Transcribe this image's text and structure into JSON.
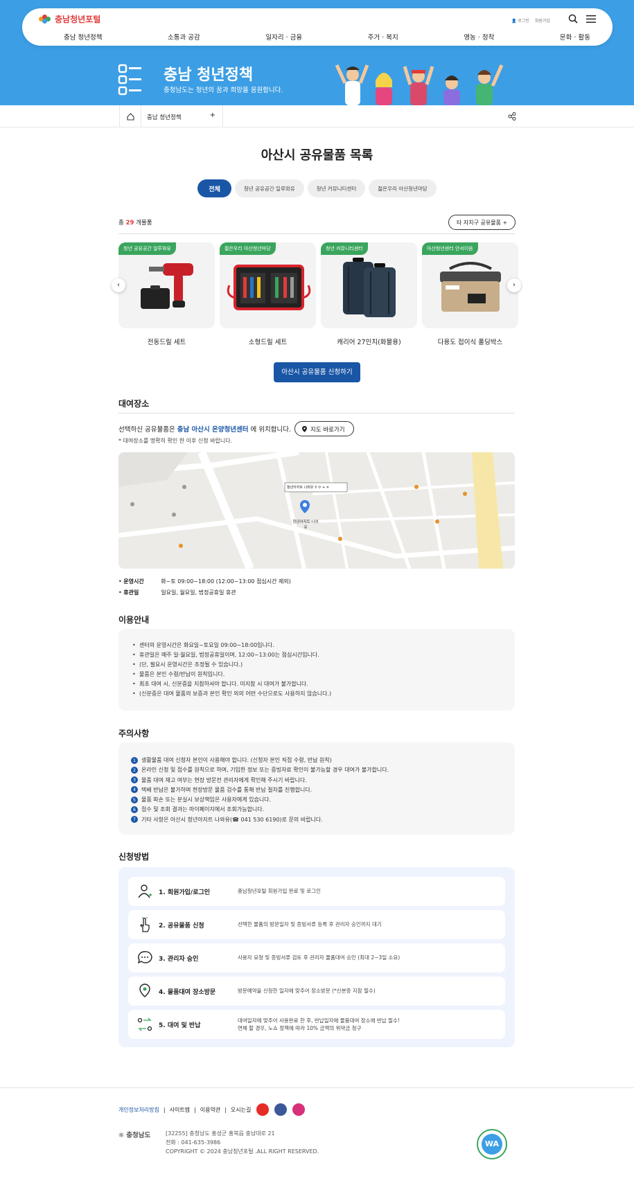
{
  "header": {
    "logo_text": "충남청년포털",
    "util_login": "로그인",
    "util_join": "회원가입",
    "gnb": [
      "충남 청년정책",
      "소통과 공감",
      "일자리 · 금융",
      "주거 · 복지",
      "영농 · 정착",
      "문화 · 활동"
    ]
  },
  "hero": {
    "title": "충남 청년정책",
    "subtitle": "충청남도는 청년의 꿈과 희망을 응원합니다."
  },
  "breadcrumb": {
    "current": "충남 청년정책",
    "toggle": "+"
  },
  "page_title": "아산시 공유물품 목록",
  "tabs": [
    "전체",
    "청년 공유공간 일루와유",
    "청년 커뮤니티센터",
    "젊은우리 아산청년마당"
  ],
  "count": {
    "prefix": "총",
    "number": "29",
    "suffix": "개물품"
  },
  "other_button": "타 자치구 공유물품 +",
  "items": [
    {
      "badge": "청년 공유공간 일루와유",
      "name": "전동드릴 세트"
    },
    {
      "badge": "젊은우리 아산청년마당",
      "name": "소형드릴 세트"
    },
    {
      "badge": "청년 커뮤니티센터",
      "name": "캐리어 27인치(화물용)"
    },
    {
      "badge": "아산청년센터 안서이음",
      "name": "다용도 접이식 폴딩박스"
    }
  ],
  "apply_button": "아산시 공유물품 신청하기",
  "location": {
    "heading": "대여장소",
    "text_prefix": "선택하신 공유물품은",
    "place": "충남 아산시 온양청년센터",
    "text_suffix": "에 위치합니다.",
    "map_button": "지도 바로가기",
    "note": "* 대여장소를 명확히 확인 한 이후 신청 바랍니다.",
    "map_popup": "청년아지트 나와유 ⚲ ⟳ + ✕",
    "map_marker_label": "청년아지트 나와유",
    "hours_label": "운영시간",
    "hours_value": "화~토 09:00~18:00 (12:00~13:00 점심시간 제외)",
    "closed_label": "휴관일",
    "closed_value": "일요일, 월요일, 법정공휴일 휴관"
  },
  "usage": {
    "heading": "이용안내",
    "items": [
      "센터의 운영시간은 화요일~토요일 09:00~18:00입니다.",
      "휴관일은 매주 일·월요일, 법정공휴일이며, 12:00~13:00는 점심시간입니다.",
      "(단, 필요시 운영시간은 조정될 수 있습니다.)",
      "물품은 본인 수령/반납이 원칙입니다.",
      "최초 대여 시, 신분증을 지참하셔야 합니다. 미지참 시 대여가 불가합니다.",
      "(신분증은 대여 물품의 보증과 본인 확인 외의 어떤 수단으로도 사용하지 않습니다.)"
    ]
  },
  "caution": {
    "heading": "주의사항",
    "items": [
      "생활물품 대여 신청자 본인이 사용해야 합니다. (신청자 본인 직접 수령, 반납 원칙)",
      "온라인 신청 및 접수를 원칙으로 하며, 기입한 정보 또는 증빙자료 확인이 불가능할 경우 대여가 불가합니다.",
      "물품 대여 재고 여부는 현장 방문전 관리자에게 확인해 주시기 바랍니다.",
      "택배 반납은 불가하며 현장방문 물품 검수를 통해 반납 절차를 진행합니다.",
      "물품 파손 또는 분실시 보상책임은 사용자에게 있습니다.",
      "접수 및 조회 결과는 마이페이지에서 조회가능합니다.",
      "기타 사항은 아산시 청년아지트 나와유(☎ 041 530 6190)로 문의 바랍니다."
    ]
  },
  "method": {
    "heading": "신청방법",
    "steps": [
      {
        "title": "1. 회원가입/로그인",
        "desc": "충남청년포털 회원가입 완료 및 로그인"
      },
      {
        "title": "2. 공유물품 신청",
        "desc": "선택한 물품의 방문일자 및 증빙서류 등록 후 관리자 승인까지 대기"
      },
      {
        "title": "3. 관리자 승인",
        "desc": "사용자 요청 및 증빙서류 검토 후 관리자 물품대여 승인 (최대 2~3일 소요)"
      },
      {
        "title": "4. 물품대여 장소방문",
        "desc": "방문예약을 신청한 일자에 맞추어 장소방문 (*신분증 지참 필수)"
      },
      {
        "title": "5. 대여 및 반납",
        "desc": "대여일자에 맞추어 사용완료 한 후, 반납일자에 물품대여 장소에 반납 필수!",
        "desc2": "연체 할 경우, 노쇼 정책에 따라 10% 금액의 위약금 청구"
      }
    ]
  },
  "footer": {
    "links": [
      "개인정보처리방침",
      "사이트맵",
      "이용약관",
      "오시는길"
    ],
    "logo_text": "충청남도",
    "address": "[32255] 충청남도 홍성군 홍북읍 충남대로 21",
    "phone": "전화 : 041-635-3986",
    "copyright": "COPYRIGHT © 2024 충남청년포털 .ALL RIGHT RESERVED.",
    "wa_text": "WA"
  },
  "colors": {
    "hero_blue": "#3c9ee4",
    "primary": "#1a56a6",
    "badge_green": "#3aa55d",
    "accent_red": "#e23b3b"
  }
}
